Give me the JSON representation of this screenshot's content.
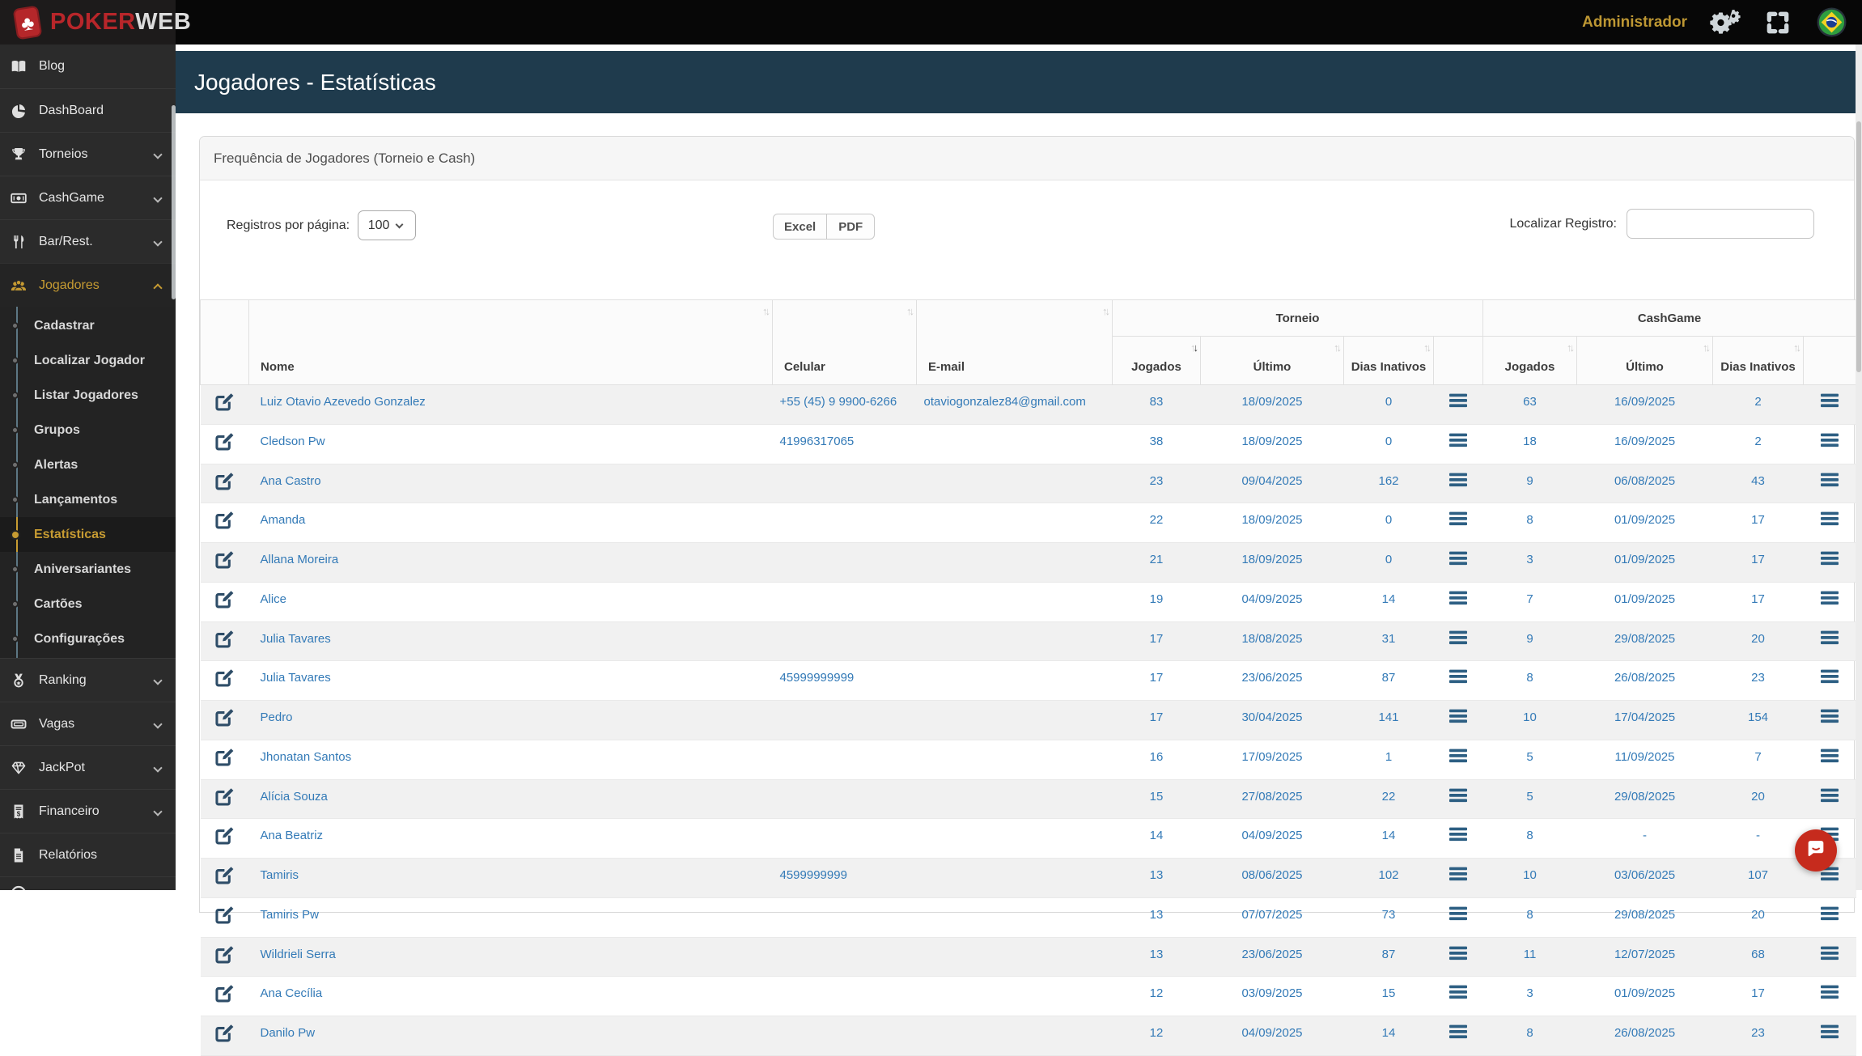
{
  "colors": {
    "brand_red": "#b8262a",
    "accent_gold": "#c69b32",
    "header_teal": "#1f3b4d",
    "link_blue": "#337ab7",
    "chat_red": "#c62b1d"
  },
  "navbar": {
    "logo_poker": "POKER",
    "logo_web": "WEB",
    "user": "Administrador",
    "icons": [
      "gears-icon",
      "fullscreen-icon",
      "brazil-flag-icon"
    ]
  },
  "sidebar": {
    "items": [
      {
        "label": "Blog",
        "icon": "book-icon"
      },
      {
        "label": "DashBoard",
        "icon": "pie-chart-icon"
      },
      {
        "label": "Torneios",
        "icon": "trophy-icon",
        "chevron": true
      },
      {
        "label": "CashGame",
        "icon": "money-icon",
        "chevron": true
      },
      {
        "label": "Bar/Rest.",
        "icon": "utensils-icon",
        "chevron": true
      },
      {
        "label": "Jogadores",
        "icon": "users-icon",
        "chevron": true,
        "open": true,
        "active": true,
        "children": [
          {
            "label": "Cadastrar"
          },
          {
            "label": "Localizar Jogador"
          },
          {
            "label": "Listar Jogadores"
          },
          {
            "label": "Grupos"
          },
          {
            "label": "Alertas"
          },
          {
            "label": "Lançamentos"
          },
          {
            "label": "Estatísticas",
            "active": true
          },
          {
            "label": "Aniversariantes"
          },
          {
            "label": "Cartões"
          },
          {
            "label": "Configurações"
          }
        ]
      },
      {
        "label": "Ranking",
        "icon": "medal-icon",
        "chevron": true
      },
      {
        "label": "Vagas",
        "icon": "ticket-icon",
        "chevron": true
      },
      {
        "label": "JackPot",
        "icon": "gem-icon",
        "chevron": true
      },
      {
        "label": "Financeiro",
        "icon": "invoice-icon",
        "chevron": true
      },
      {
        "label": "Relatórios",
        "icon": "file-icon"
      }
    ]
  },
  "page": {
    "title": "Jogadores - Estatísticas"
  },
  "panel": {
    "title": "Frequência de Jogadores (Torneio e Cash)"
  },
  "controls": {
    "per_page_label": "Registros por página:",
    "per_page_value": "100",
    "excel_label": "Excel",
    "pdf_label": "PDF",
    "search_label": "Localizar Registro:",
    "search_value": ""
  },
  "table": {
    "group_tournament": "Torneio",
    "group_cashgame": "CashGame",
    "col_name": "Nome",
    "col_phone": "Celular",
    "col_email": "E-mail",
    "col_played": "Jogados",
    "col_last": "Último",
    "col_days": "Dias Inativos",
    "rows": [
      {
        "name": "Luiz Otavio Azevedo Gonzalez",
        "phone": "+55 (45) 9 9900-6266",
        "email": "otaviogonzalez84@gmail.com",
        "t_played": "83",
        "t_last": "18/09/2025",
        "t_days": "0",
        "c_played": "63",
        "c_last": "16/09/2025",
        "c_days": "2"
      },
      {
        "name": "Cledson Pw",
        "phone": "41996317065",
        "email": "",
        "t_played": "38",
        "t_last": "18/09/2025",
        "t_days": "0",
        "c_played": "18",
        "c_last": "16/09/2025",
        "c_days": "2"
      },
      {
        "name": "Ana Castro",
        "phone": "",
        "email": "",
        "t_played": "23",
        "t_last": "09/04/2025",
        "t_days": "162",
        "c_played": "9",
        "c_last": "06/08/2025",
        "c_days": "43"
      },
      {
        "name": "Amanda",
        "phone": "",
        "email": "",
        "t_played": "22",
        "t_last": "18/09/2025",
        "t_days": "0",
        "c_played": "8",
        "c_last": "01/09/2025",
        "c_days": "17"
      },
      {
        "name": "Allana Moreira",
        "phone": "",
        "email": "",
        "t_played": "21",
        "t_last": "18/09/2025",
        "t_days": "0",
        "c_played": "3",
        "c_last": "01/09/2025",
        "c_days": "17"
      },
      {
        "name": "Alice",
        "phone": "",
        "email": "",
        "t_played": "19",
        "t_last": "04/09/2025",
        "t_days": "14",
        "c_played": "7",
        "c_last": "01/09/2025",
        "c_days": "17"
      },
      {
        "name": "Julia Tavares",
        "phone": "",
        "email": "",
        "t_played": "17",
        "t_last": "18/08/2025",
        "t_days": "31",
        "c_played": "9",
        "c_last": "29/08/2025",
        "c_days": "20"
      },
      {
        "name": "Julia Tavares",
        "phone": "45999999999",
        "email": "",
        "t_played": "17",
        "t_last": "23/06/2025",
        "t_days": "87",
        "c_played": "8",
        "c_last": "26/08/2025",
        "c_days": "23"
      },
      {
        "name": "Pedro",
        "phone": "",
        "email": "",
        "t_played": "17",
        "t_last": "30/04/2025",
        "t_days": "141",
        "c_played": "10",
        "c_last": "17/04/2025",
        "c_days": "154"
      },
      {
        "name": "Jhonatan Santos",
        "phone": "",
        "email": "",
        "t_played": "16",
        "t_last": "17/09/2025",
        "t_days": "1",
        "c_played": "5",
        "c_last": "11/09/2025",
        "c_days": "7"
      },
      {
        "name": "Alícia Souza",
        "phone": "",
        "email": "",
        "t_played": "15",
        "t_last": "27/08/2025",
        "t_days": "22",
        "c_played": "5",
        "c_last": "29/08/2025",
        "c_days": "20"
      },
      {
        "name": "Ana Beatriz",
        "phone": "",
        "email": "",
        "t_played": "14",
        "t_last": "04/09/2025",
        "t_days": "14",
        "c_played": "8",
        "c_last": "-",
        "c_days": "-"
      },
      {
        "name": "Tamiris",
        "phone": "4599999999",
        "email": "",
        "t_played": "13",
        "t_last": "08/06/2025",
        "t_days": "102",
        "c_played": "10",
        "c_last": "03/06/2025",
        "c_days": "107"
      },
      {
        "name": "Tamiris Pw",
        "phone": "",
        "email": "",
        "t_played": "13",
        "t_last": "07/07/2025",
        "t_days": "73",
        "c_played": "8",
        "c_last": "29/08/2025",
        "c_days": "20"
      },
      {
        "name": "Wildrieli Serra",
        "phone": "",
        "email": "",
        "t_played": "13",
        "t_last": "23/06/2025",
        "t_days": "87",
        "c_played": "11",
        "c_last": "12/07/2025",
        "c_days": "68"
      },
      {
        "name": "Ana Cecília",
        "phone": "",
        "email": "",
        "t_played": "12",
        "t_last": "03/09/2025",
        "t_days": "15",
        "c_played": "3",
        "c_last": "01/09/2025",
        "c_days": "17"
      },
      {
        "name": "Danilo Pw",
        "phone": "",
        "email": "",
        "t_played": "12",
        "t_last": "04/09/2025",
        "t_days": "14",
        "c_played": "8",
        "c_last": "26/08/2025",
        "c_days": "23"
      }
    ]
  }
}
